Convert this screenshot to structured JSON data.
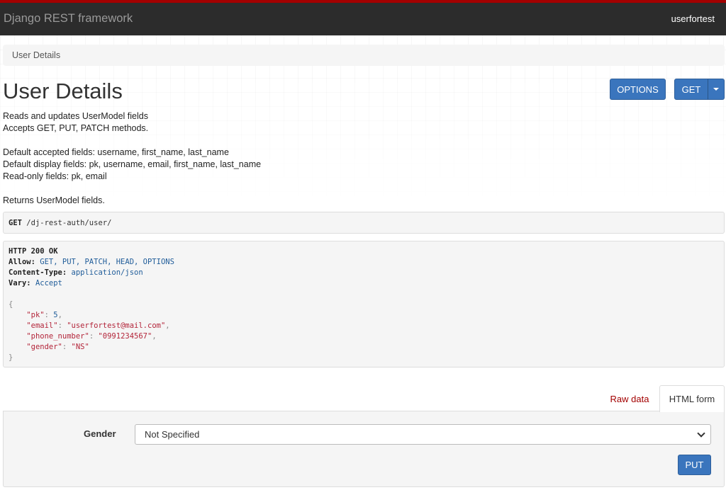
{
  "navbar": {
    "brand": "Django REST framework",
    "user": "userfortest"
  },
  "breadcrumb": {
    "current": "User Details"
  },
  "page": {
    "title": "User Details",
    "description_lines": [
      "Reads and updates UserModel fields",
      "Accepts GET, PUT, PATCH methods.",
      "",
      "Default accepted fields: username, first_name, last_name",
      "Default display fields: pk, username, email, first_name, last_name",
      "Read-only fields: pk, email",
      "",
      "Returns UserModel fields."
    ]
  },
  "toolbar": {
    "options_label": "OPTIONS",
    "get_label": "GET"
  },
  "request": {
    "method": "GET",
    "path": "/dj-rest-auth/user/"
  },
  "response": {
    "status_line": "HTTP 200 OK",
    "headers": [
      {
        "name": "Allow:",
        "value": "GET, PUT, PATCH, HEAD, OPTIONS"
      },
      {
        "name": "Content-Type:",
        "value": "application/json"
      },
      {
        "name": "Vary:",
        "value": "Accept"
      }
    ],
    "body_open": "{",
    "body_close": "}",
    "fields": [
      {
        "key": "\"pk\"",
        "value": "5",
        "trailer": ","
      },
      {
        "key": "\"email\"",
        "value": "\"userfortest@mail.com\"",
        "trailer": ","
      },
      {
        "key": "\"phone_number\"",
        "value": "\"0991234567\"",
        "trailer": ","
      },
      {
        "key": "\"gender\"",
        "value": "\"NS\"",
        "trailer": ""
      }
    ],
    "colon": ": "
  },
  "form_tabs": {
    "raw_label": "Raw data",
    "html_label": "HTML form"
  },
  "form": {
    "gender_label": "Gender",
    "gender_value": "Not Specified",
    "submit_label": "PUT"
  },
  "colors": {
    "accent": "#a30000",
    "primary_button": "#3a75bd",
    "navbar": "#2c2c2c"
  }
}
